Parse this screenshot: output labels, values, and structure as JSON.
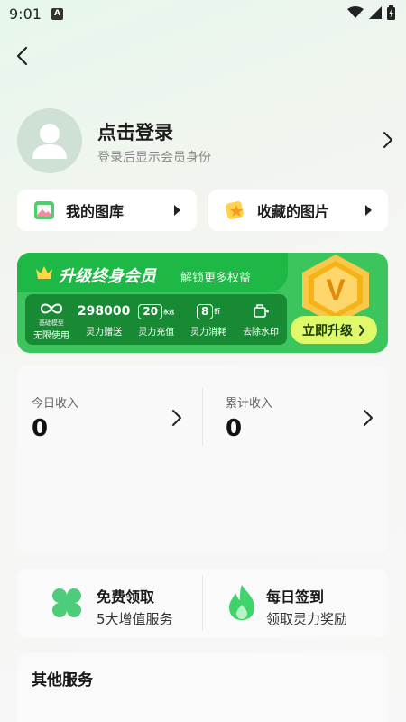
{
  "status_bar": {
    "time": "9:01",
    "notification_badge": "A"
  },
  "profile": {
    "title": "点击登录",
    "subtitle": "登录后显示会员身份"
  },
  "quick_links": [
    {
      "label": "我的图库",
      "icon": "gallery-icon"
    },
    {
      "label": "收藏的图片",
      "icon": "star-icon"
    }
  ],
  "vip_banner": {
    "title": "升级终身会员",
    "subtitle": "解锁更多权益",
    "features": [
      {
        "top_text": "∞",
        "small_label": "基础模型",
        "label": "无限使用"
      },
      {
        "top_text": "298000",
        "label": "灵力赠送"
      },
      {
        "top_text": "20",
        "top_suffix": "永远",
        "label": "灵力充值"
      },
      {
        "top_text": "8",
        "top_suffix": "折",
        "label": "灵力消耗"
      },
      {
        "top_text": "",
        "label": "去除水印"
      }
    ],
    "medal_letter": "V",
    "upgrade_button": "立即升级"
  },
  "income": {
    "today_label": "今日收入",
    "today_value": "0",
    "total_label": "累计收入",
    "total_value": "0"
  },
  "perks": [
    {
      "title": "免费领取",
      "subtitle": "5大增值服务",
      "icon": "clover-icon"
    },
    {
      "title": "每日签到",
      "subtitle": "领取灵力奖励",
      "icon": "flame-icon"
    }
  ],
  "other_services": {
    "title": "其他服务"
  },
  "colors": {
    "accent_green": "#1db845",
    "button_lime": "#dff96b",
    "medal_gold": "#f5b316"
  }
}
